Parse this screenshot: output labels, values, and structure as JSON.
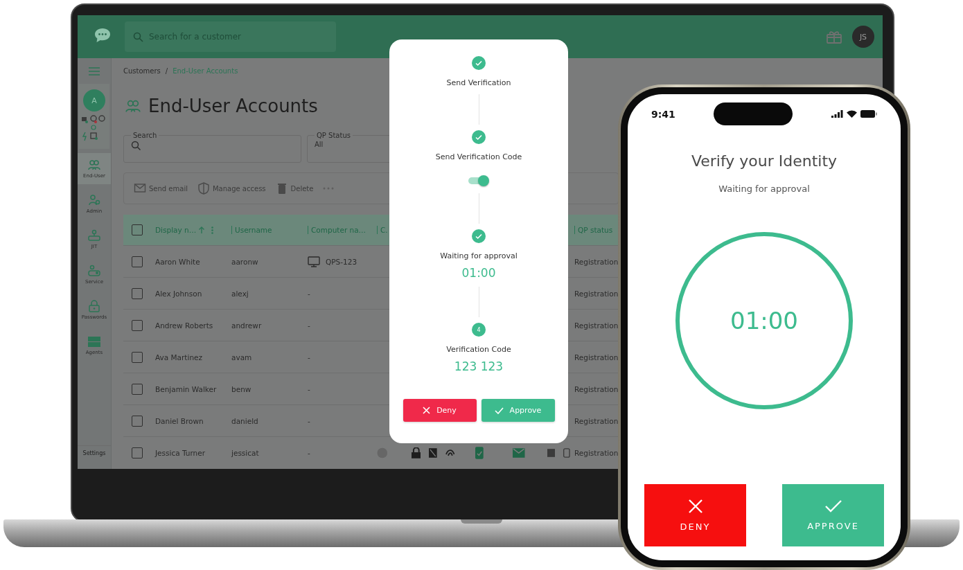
{
  "laptop_app": {
    "header": {
      "search_placeholder": "Search for a customer",
      "avatar_initials": "JS"
    },
    "sidebar": {
      "account_initial": "A",
      "items": [
        {
          "label": "End-User",
          "selected": true
        },
        {
          "label": "Admin",
          "selected": false
        },
        {
          "label": "JIT",
          "selected": false
        },
        {
          "label": "Service",
          "selected": false
        },
        {
          "label": "Passwords",
          "selected": false
        },
        {
          "label": "Agents",
          "selected": false
        }
      ],
      "footer_label": "Settings"
    },
    "breadcrumbs": [
      {
        "label": "Customers",
        "current": false
      },
      {
        "label": "End-User Accounts",
        "current": true
      }
    ],
    "breadcrumb_separator": "/",
    "page_title": "End-User Accounts",
    "filters": [
      {
        "label": "Search",
        "kind": "search"
      },
      {
        "label": "QP Status",
        "kind": "select",
        "value": "All"
      }
    ],
    "toolbar": [
      {
        "label": "Send email",
        "kind": "mail",
        "disabled": true
      },
      {
        "label": "Manage access",
        "kind": "shield",
        "disabled": true
      },
      {
        "label": "Delete",
        "kind": "trash",
        "disabled": true
      }
    ],
    "table": {
      "select_all_checked": false,
      "columns": [
        {
          "label": "Display n…",
          "sorted": true
        },
        {
          "label": "Username",
          "sorted": false
        },
        {
          "label": "Computer na…",
          "sorted": false
        },
        {
          "label": "C.",
          "sorted": false
        },
        {
          "label": "QP status",
          "sorted": false
        }
      ],
      "rows": [
        {
          "display_name": "Aaron White",
          "username": "aaronw",
          "computer": "QPS-123",
          "has_device": true,
          "status_icons": false,
          "qp_status": "Registration",
          "checked": false
        },
        {
          "display_name": "Alex Johnson",
          "username": "alexj",
          "computer": "-",
          "has_device": false,
          "status_icons": false,
          "qp_status": "Registration",
          "checked": false
        },
        {
          "display_name": "Andrew Roberts",
          "username": "andrewr",
          "computer": "-",
          "has_device": false,
          "status_icons": false,
          "qp_status": "Registration",
          "checked": false
        },
        {
          "display_name": "Ava Martinez",
          "username": "avam",
          "computer": "-",
          "has_device": false,
          "status_icons": false,
          "qp_status": "Registration",
          "checked": false
        },
        {
          "display_name": "Benjamin Walker",
          "username": "benw",
          "computer": "-",
          "has_device": false,
          "status_icons": false,
          "qp_status": "Registration",
          "checked": false
        },
        {
          "display_name": "Daniel Brown",
          "username": "danield",
          "computer": "-",
          "has_device": false,
          "status_icons": false,
          "qp_status": "Registration",
          "checked": false
        },
        {
          "display_name": "Jessica Turner",
          "username": "jessicat",
          "computer": "-",
          "has_device": false,
          "status_icons": true,
          "qp_status": "Registration",
          "checked": false
        }
      ]
    }
  },
  "verification_dialog": {
    "steps": [
      {
        "kind": "check",
        "label": "Send Verification"
      },
      {
        "kind": "check",
        "label": "Send Verification Code",
        "toggle": {
          "on": true
        }
      },
      {
        "kind": "check",
        "label": "Waiting for approval",
        "value": "01:00"
      },
      {
        "kind": "number",
        "number": "4",
        "label": "Verification Code",
        "value": "123 123"
      }
    ],
    "buttons": [
      {
        "label": "Deny",
        "kind": "deny"
      },
      {
        "label": "Approve",
        "kind": "approve"
      }
    ]
  },
  "phone": {
    "status_bar": {
      "time": "9:41"
    },
    "title": "Verify your Identity",
    "subtitle": "Waiting for approval",
    "timer": "01:00",
    "buttons": [
      {
        "label": "DENY",
        "kind": "deny"
      },
      {
        "label": "APPROVE",
        "kind": "approve"
      }
    ]
  }
}
